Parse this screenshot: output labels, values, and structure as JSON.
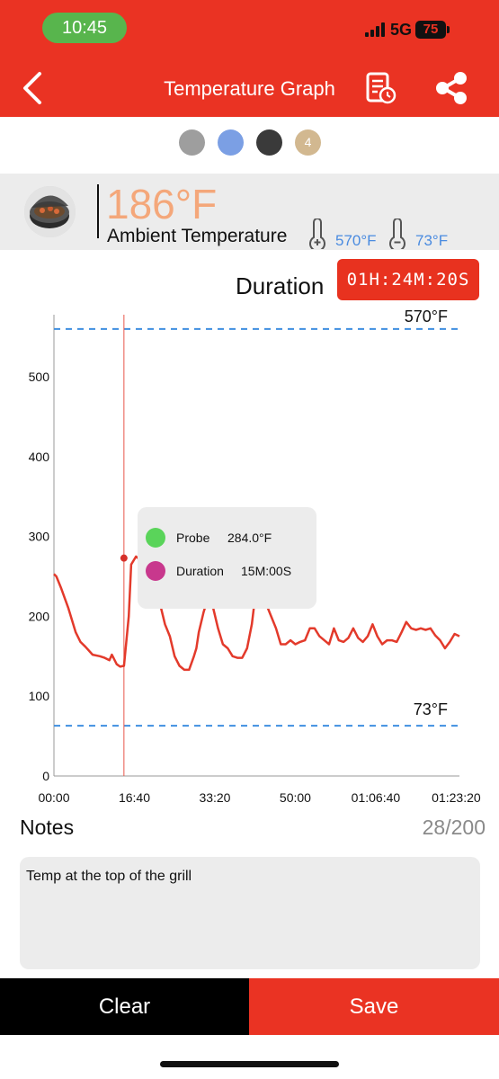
{
  "status_bar": {
    "time": "10:45",
    "network": "5G",
    "battery": "75"
  },
  "header": {
    "title": "Temperature Graph",
    "back_icon": "chevron-left-icon",
    "report_icon": "report-clock-icon",
    "share_icon": "share-icon"
  },
  "probe_selector": [
    {
      "label": "",
      "color": "#9e9e9e"
    },
    {
      "label": "",
      "color": "#7b9fe4"
    },
    {
      "label": "",
      "color": "#3a3a3a"
    },
    {
      "label": "4",
      "color": "#d2b890"
    }
  ],
  "ambient": {
    "temperature": "186°F",
    "label": "Ambient Temperature",
    "high_alarm": "570°F",
    "low_alarm": "73°F"
  },
  "duration": {
    "label": "Duration",
    "value": "01H:24M:20S"
  },
  "chart_data": {
    "type": "line",
    "xlabel": "",
    "ylabel": "",
    "x_ticks": [
      "00:00",
      "16:40",
      "33:20",
      "50:00",
      "01:06:40",
      "01:23:20"
    ],
    "y_ticks": [
      "0",
      "100",
      "200",
      "300",
      "400",
      "500"
    ],
    "xlim": [
      0,
      84
    ],
    "ylim": [
      0,
      570
    ],
    "grid": false,
    "series": [
      {
        "color": "#e33a2b",
        "x": [
          0,
          0.5,
          1.5,
          3,
          4.5,
          5.5,
          6.5,
          8,
          9.5,
          10.5,
          11.5,
          12,
          13,
          13.7,
          14.5,
          15.5,
          16,
          17,
          18,
          19,
          20,
          21,
          22,
          23,
          24,
          25,
          26,
          27,
          28,
          29,
          29.5,
          30,
          31,
          32,
          32.5,
          33,
          34,
          35,
          36,
          37,
          38,
          39,
          40,
          41,
          42,
          43,
          43.5,
          44,
          45,
          46,
          47,
          48,
          49,
          50,
          51,
          52,
          53,
          54,
          55,
          56,
          57,
          58,
          59,
          60,
          61,
          62,
          63,
          64,
          65,
          66,
          67,
          68,
          69,
          70,
          71,
          72,
          73,
          74,
          75,
          76,
          77,
          78,
          79,
          80,
          81,
          82,
          83,
          84
        ],
        "y": [
          253,
          250,
          235,
          210,
          180,
          168,
          162,
          152,
          150,
          148,
          145,
          152,
          140,
          137,
          138,
          200,
          265,
          275,
          270,
          258,
          252,
          240,
          215,
          190,
          175,
          150,
          138,
          133,
          133,
          150,
          160,
          180,
          205,
          225,
          230,
          210,
          185,
          165,
          160,
          150,
          148,
          148,
          160,
          190,
          240,
          290,
          250,
          215,
          200,
          185,
          165,
          165,
          170,
          165,
          168,
          170,
          185,
          185,
          175,
          170,
          165,
          185,
          170,
          168,
          173,
          185,
          173,
          168,
          175,
          190,
          175,
          165,
          170,
          170,
          168,
          180,
          193,
          185,
          183,
          185,
          183,
          185,
          176,
          170,
          160,
          168,
          178,
          175
        ]
      }
    ],
    "high_line": {
      "value": 560,
      "label": "570°F"
    },
    "low_line": {
      "value": 63,
      "label": "73°F"
    },
    "cursor": {
      "x": 14.5
    },
    "tooltip": {
      "rows": [
        {
          "name": "Probe",
          "value": "284.0°F",
          "color": "#5ad45a"
        },
        {
          "name": "Duration",
          "value": "15M:00S",
          "color": "#c8388d"
        }
      ]
    }
  },
  "notes": {
    "label": "Notes",
    "count": "28/200",
    "text": "Temp at the top of the grill"
  },
  "actions": {
    "clear": "Clear",
    "save": "Save"
  }
}
